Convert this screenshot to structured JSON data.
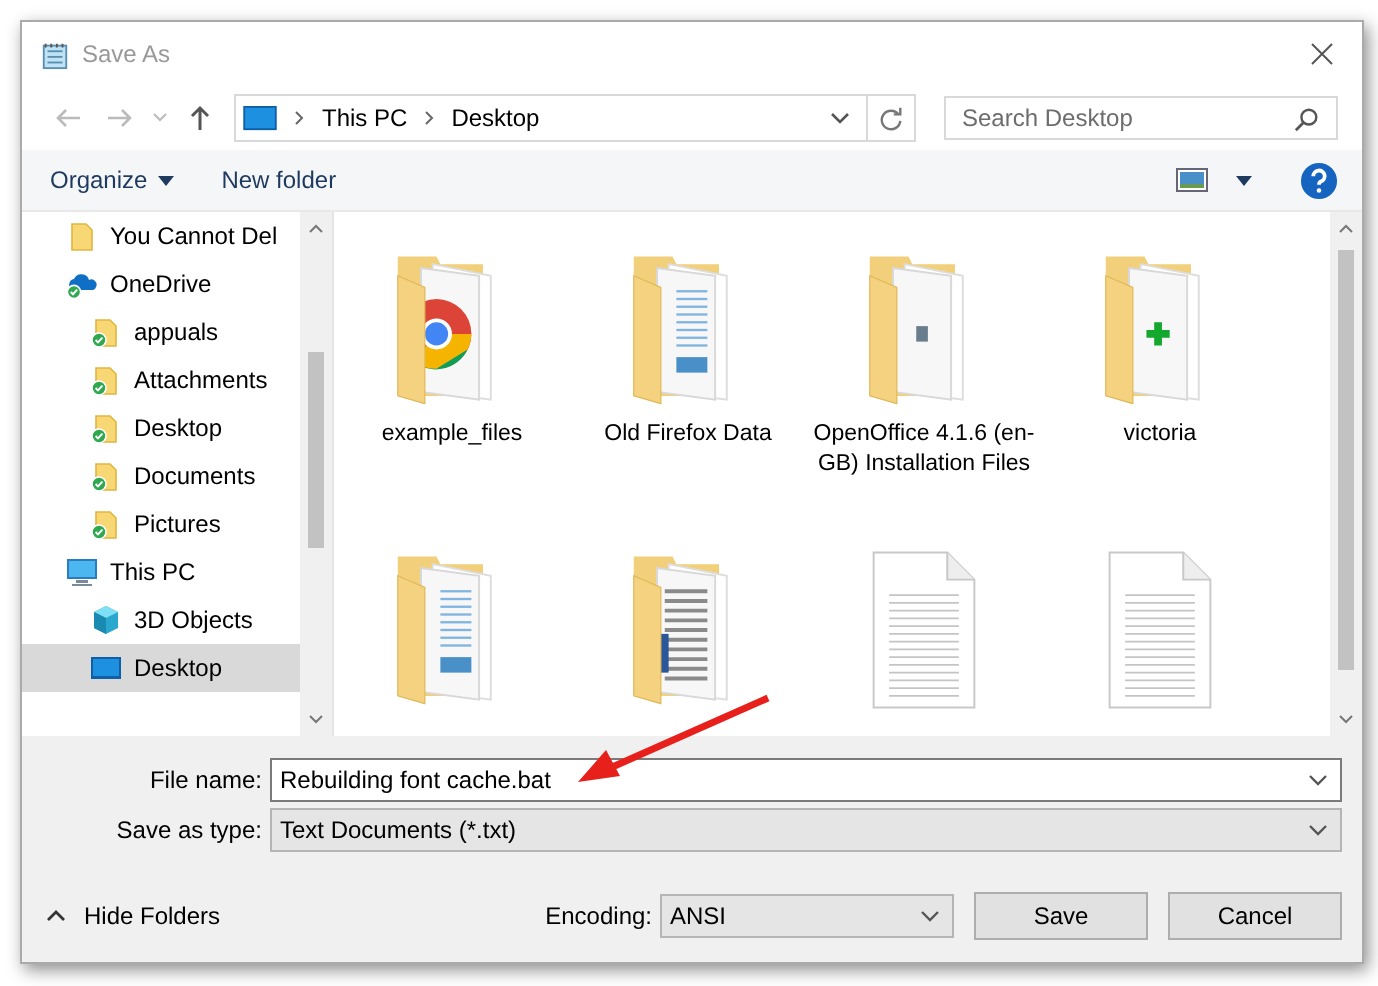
{
  "window": {
    "title": "Save As"
  },
  "address_bar": {
    "segments": [
      "This PC",
      "Desktop"
    ]
  },
  "search": {
    "placeholder": "Search Desktop"
  },
  "toolbar": {
    "organize": "Organize",
    "new_folder": "New folder"
  },
  "sidebar": {
    "items": [
      {
        "label": "You Cannot Del",
        "kind": "folder",
        "selected": false
      },
      {
        "label": "OneDrive",
        "kind": "cloud",
        "selected": false,
        "children": [
          {
            "label": "appuals",
            "kind": "synced-folder",
            "selected": false
          },
          {
            "label": "Attachments",
            "kind": "synced-folder",
            "selected": false
          },
          {
            "label": "Desktop",
            "kind": "synced-folder",
            "selected": false
          },
          {
            "label": "Documents",
            "kind": "synced-folder",
            "selected": false
          },
          {
            "label": "Pictures",
            "kind": "synced-folder",
            "selected": false
          }
        ]
      },
      {
        "label": "This PC",
        "kind": "pc",
        "selected": false,
        "children": [
          {
            "label": "3D Objects",
            "kind": "cube",
            "selected": false
          },
          {
            "label": "Desktop",
            "kind": "desktop",
            "selected": true
          }
        ]
      }
    ]
  },
  "files": [
    {
      "label": "example_files",
      "kind": "chrome-folder"
    },
    {
      "label": "Old Firefox Data",
      "kind": "doc-folder"
    },
    {
      "label": "OpenOffice 4.1.6 (en-GB) Installation Files",
      "kind": "app-folder"
    },
    {
      "label": "victoria",
      "kind": "plus-folder"
    },
    {
      "kind": "doc-folder"
    },
    {
      "kind": "word-folder"
    },
    {
      "kind": "text-file"
    },
    {
      "kind": "text-file"
    }
  ],
  "form": {
    "file_name_label": "File name:",
    "file_name": "Rebuilding font cache.bat",
    "type_label": "Save as type:",
    "type": "Text Documents (*.txt)"
  },
  "footer": {
    "hide_folders": "Hide Folders",
    "encoding_label": "Encoding:",
    "encoding": "ANSI",
    "save": "Save",
    "cancel": "Cancel"
  }
}
